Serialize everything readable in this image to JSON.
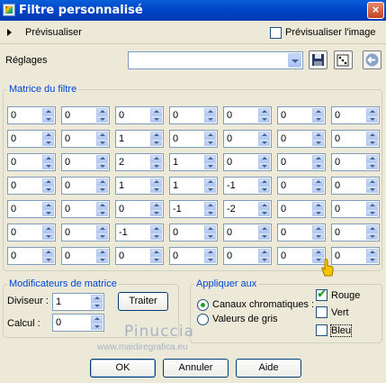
{
  "window": {
    "title": "Filtre personnalisé",
    "close_glyph": "×"
  },
  "preview": {
    "label": "Prévisualiser",
    "image_checkbox_label": "Prévisualiser l'image",
    "image_checked": false
  },
  "presets": {
    "label": "Réglages",
    "value": ""
  },
  "matrix": {
    "legend": "Matrice du filtre",
    "rows": [
      [
        "0",
        "0",
        "0",
        "0",
        "0",
        "0",
        "0"
      ],
      [
        "0",
        "0",
        "1",
        "0",
        "0",
        "0",
        "0"
      ],
      [
        "0",
        "0",
        "2",
        "1",
        "0",
        "0",
        "0"
      ],
      [
        "0",
        "0",
        "1",
        "1",
        "-1",
        "0",
        "0"
      ],
      [
        "0",
        "0",
        "0",
        "-1",
        "-2",
        "0",
        "0"
      ],
      [
        "0",
        "0",
        "-1",
        "0",
        "0",
        "0",
        "0"
      ],
      [
        "0",
        "0",
        "0",
        "0",
        "0",
        "0",
        "0"
      ]
    ]
  },
  "modifiers": {
    "legend": "Modificateurs de matrice",
    "divisor_label": "Diviseur :",
    "divisor_value": "1",
    "bias_label": "Calcul :",
    "bias_value": "0",
    "process_button": "Traiter"
  },
  "apply_to": {
    "legend": "Appliquer aux",
    "channels_label": "Canaux chromatiques :",
    "grayscale_label": "Valeurs de gris",
    "selected": "channels",
    "red_label": "Rouge",
    "red_checked": true,
    "green_label": "Vert",
    "green_checked": false,
    "blue_label": "Bleu",
    "blue_checked": false
  },
  "buttons": {
    "ok": "OK",
    "cancel": "Annuler",
    "help": "Aide"
  },
  "watermark": {
    "name": "Pinuccia",
    "site": "www.maidiregrafica.eu"
  },
  "colors": {
    "titlebar": "#0045c8",
    "legend": "#0046d5",
    "check": "#21a121"
  }
}
